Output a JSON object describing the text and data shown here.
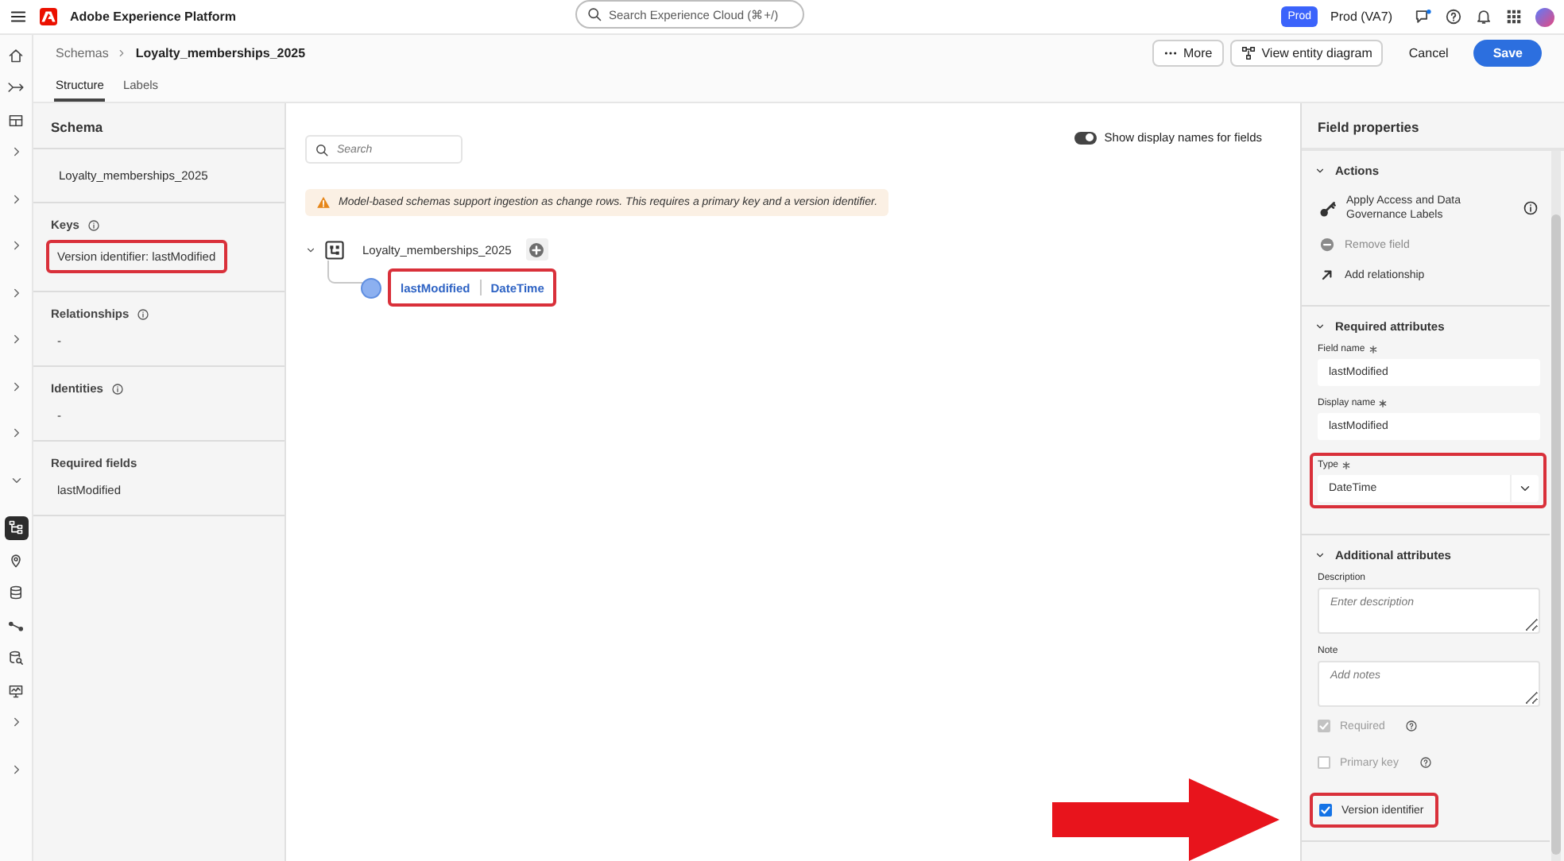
{
  "top_bar": {
    "product": "Adobe Experience Platform",
    "search": {
      "placeholder": "Search Experience Cloud (⌘+/)"
    },
    "sandbox_badge": "Prod",
    "sandbox": "Prod (VA7)"
  },
  "header": {
    "breadcrumbs": [
      {
        "label": "Schemas",
        "current": false
      },
      {
        "label": "Loyalty_memberships_2025",
        "current": true
      }
    ],
    "buttons": [
      {
        "kind": "more",
        "label": "More"
      },
      {
        "kind": "diagram",
        "label": "View entity diagram"
      },
      {
        "kind": "quiet",
        "label": "Cancel"
      },
      {
        "kind": "primary",
        "label": "Save"
      }
    ]
  },
  "tabs": [
    {
      "label": "Structure",
      "selected": true
    },
    {
      "label": "Labels",
      "selected": false
    }
  ],
  "rail": [
    {
      "kind": "home",
      "selected": false
    },
    {
      "kind": "journey",
      "selected": false
    },
    {
      "kind": "layout",
      "selected": false
    },
    {
      "kind": "chevron-right",
      "selected": false
    },
    {
      "kind": "chevron-right",
      "selected": false
    },
    {
      "kind": "chevron-right",
      "selected": false
    },
    {
      "kind": "chevron-right",
      "selected": false
    },
    {
      "kind": "chevron-right",
      "selected": false
    },
    {
      "kind": "chevron-right",
      "selected": false
    },
    {
      "kind": "chevron-right",
      "selected": false
    },
    {
      "kind": "chevron-down",
      "selected": false
    },
    {
      "kind": "schema",
      "selected": true
    },
    {
      "kind": "pin",
      "selected": false
    },
    {
      "kind": "database",
      "selected": false
    },
    {
      "kind": "flow",
      "selected": false
    },
    {
      "kind": "query",
      "selected": false
    },
    {
      "kind": "monitor",
      "selected": false
    },
    {
      "kind": "chevron-right",
      "selected": false
    },
    {
      "kind": "chevron-right",
      "selected": false
    }
  ],
  "schema_panel": {
    "title": "Schema",
    "name": "Loyalty_memberships_2025",
    "sections": [
      {
        "title": "Keys",
        "info": true,
        "items": [
          {
            "text": "Version identifier: lastModified",
            "highlighted": true
          }
        ]
      },
      {
        "title": "Relationships",
        "info": true,
        "items": [
          {
            "text": "-",
            "highlighted": false
          }
        ]
      },
      {
        "title": "Identities",
        "info": true,
        "items": [
          {
            "text": "-",
            "highlighted": false
          }
        ]
      },
      {
        "title": "Required fields",
        "info": false,
        "items": [
          {
            "text": "lastModified",
            "highlighted": false
          }
        ]
      }
    ]
  },
  "canvas": {
    "search": {
      "placeholder": "Search"
    },
    "toggle": {
      "label": "Show display names for fields",
      "on": true
    },
    "warning": "Model-based schemas support ingestion as change rows. This requires a primary key and a version identifier.",
    "tree": {
      "name": "Loyalty_memberships_2025",
      "expanded": true,
      "children": [
        {
          "name": "lastModified",
          "type": "DateTime",
          "highlighted": true
        }
      ]
    }
  },
  "field_properties": {
    "title": "Field properties",
    "sections": [
      {
        "title": "Actions",
        "expanded": true,
        "actions": [
          {
            "kind": "labels",
            "label": "Apply Access and Data Governance Labels",
            "info": true,
            "disabled": false
          },
          {
            "kind": "remove",
            "label": "Remove field",
            "info": false,
            "disabled": true
          },
          {
            "kind": "relationship",
            "label": "Add relationship",
            "info": false,
            "disabled": false
          }
        ]
      },
      {
        "title": "Required attributes",
        "expanded": true,
        "fields": [
          {
            "kind": "text",
            "label": "Field name",
            "required": true,
            "value": "lastModified",
            "highlighted": false
          },
          {
            "kind": "text",
            "label": "Display name",
            "required": true,
            "value": "lastModified",
            "highlighted": false
          },
          {
            "kind": "select",
            "label": "Type",
            "required": true,
            "value": "DateTime",
            "highlighted": true
          }
        ]
      },
      {
        "title": "Additional attributes",
        "expanded": true,
        "fields": [
          {
            "kind": "textarea",
            "label": "Description",
            "required": false,
            "placeholder": "Enter description",
            "highlighted": false
          },
          {
            "kind": "textarea",
            "label": "Note",
            "required": false,
            "placeholder": "Add notes",
            "highlighted": false
          },
          {
            "kind": "checkbox",
            "label": "Required",
            "checked": true,
            "disabled": true,
            "help": true,
            "highlighted": false,
            "pointer": false
          },
          {
            "kind": "checkbox",
            "label": "Primary key",
            "checked": false,
            "disabled": true,
            "help": true,
            "highlighted": false,
            "pointer": false
          },
          {
            "kind": "checkbox",
            "label": "Version identifier",
            "checked": true,
            "disabled": false,
            "help": false,
            "highlighted": true,
            "pointer": true
          }
        ]
      }
    ]
  }
}
